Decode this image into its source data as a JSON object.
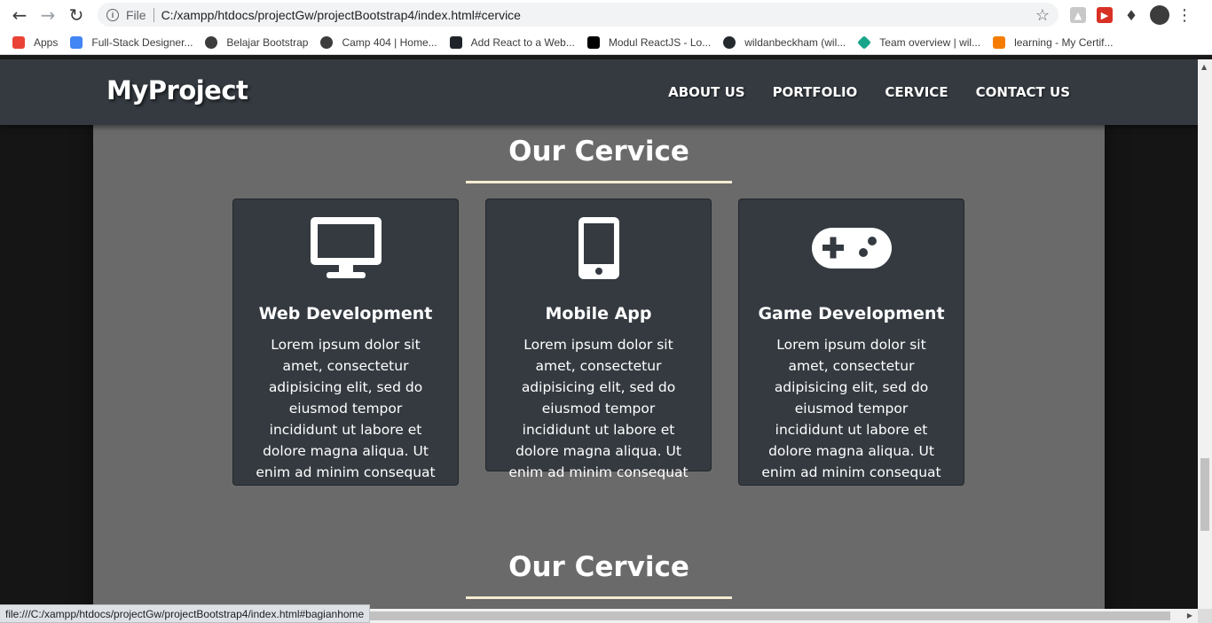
{
  "browser": {
    "url_scheme": "File",
    "url": "C:/xampp/htdocs/projectGw/projectBootstrap4/index.html#cervice",
    "bookmarks": [
      {
        "label": "Apps",
        "icon": "apps-grid-icon",
        "color": "#ea4335"
      },
      {
        "label": "Full-Stack Designer...",
        "icon": "site-icon",
        "color": "#4285f4"
      },
      {
        "label": "Belajar Bootstrap",
        "icon": "globe-icon",
        "color": "#3c3c3c"
      },
      {
        "label": "Camp 404 | Home...",
        "icon": "globe-icon",
        "color": "#3c3c3c"
      },
      {
        "label": "Add React to a Web...",
        "icon": "react-icon",
        "color": "#20232a"
      },
      {
        "label": "Modul ReactJS - Lo...",
        "icon": "notion-icon",
        "color": "#000000"
      },
      {
        "label": "wildanbeckham (wil...",
        "icon": "github-icon",
        "color": "#24292e"
      },
      {
        "label": "Team overview | wil...",
        "icon": "diamond-icon",
        "color": "#17a589"
      },
      {
        "label": "learning - My Certif...",
        "icon": "bracket-icon",
        "color": "#f57c00"
      }
    ],
    "status_url": "file:///C:/xampp/htdocs/projectGw/projectBootstrap4/index.html#bagianhome"
  },
  "site": {
    "brand": "MyProject",
    "menu": [
      "ABOUT US",
      "PORTFOLIO",
      "CERVICE",
      "CONTACT US"
    ]
  },
  "section": {
    "title": "Our Cervice",
    "next_title": "Our Cervice",
    "cards": [
      {
        "icon": "desktop-icon",
        "title": "Web Development",
        "text": "Lorem ipsum dolor sit amet, consectetur adipisicing elit, sed do eiusmod tempor incididunt ut labore et dolore magna aliqua. Ut enim ad minim consequat"
      },
      {
        "icon": "mobile-icon",
        "title": "Mobile App",
        "text": "Lorem ipsum dolor sit amet, consectetur adipisicing elit, sed do eiusmod tempor incididunt ut labore et dolore magna aliqua. Ut enim ad minim consequat"
      },
      {
        "icon": "gamepad-icon",
        "title": "Game Development",
        "text": "Lorem ipsum dolor sit amet, consectetur adipisicing elit, sed do eiusmod tempor incididunt ut labore et dolore magna aliqua. Ut enim ad minim consequat"
      }
    ]
  },
  "colors": {
    "navbar": "#343a40",
    "container": "#6a6a6a",
    "card": "#343a40",
    "rule": "#f5ecd2"
  }
}
